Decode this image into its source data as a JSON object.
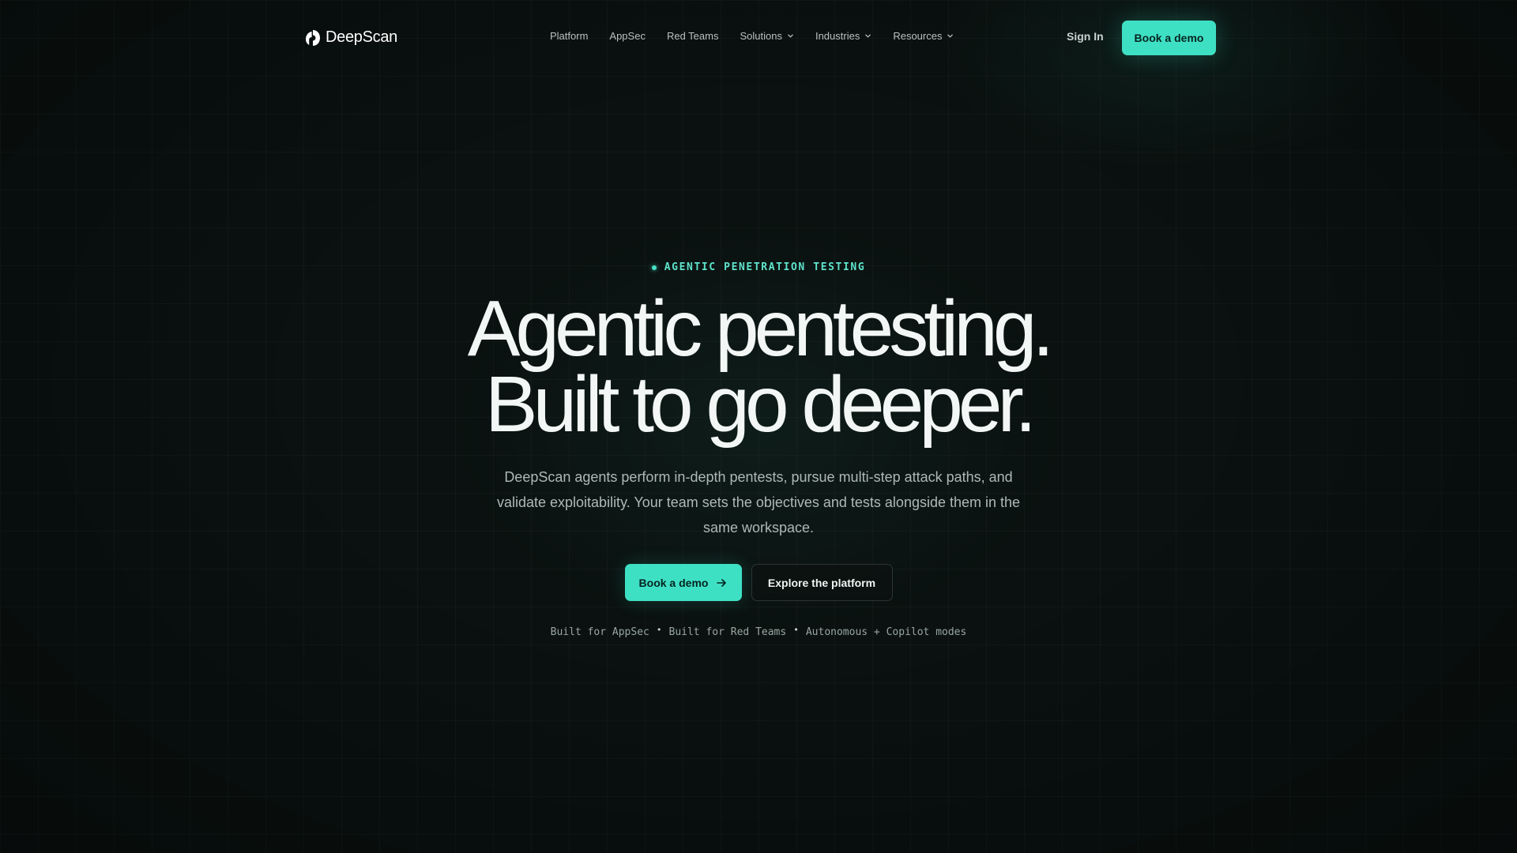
{
  "brand": {
    "name": "DeepScan",
    "accent_color": "#3ee0c4"
  },
  "nav": {
    "links": [
      {
        "label": "Platform",
        "has_dropdown": false
      },
      {
        "label": "AppSec",
        "has_dropdown": false
      },
      {
        "label": "Red Teams",
        "has_dropdown": false
      },
      {
        "label": "Solutions",
        "has_dropdown": true
      },
      {
        "label": "Industries",
        "has_dropdown": true
      },
      {
        "label": "Resources",
        "has_dropdown": true
      }
    ],
    "sign_in_label": "Sign In",
    "demo_label": "Book a demo"
  },
  "hero": {
    "eyebrow": "AGENTIC PENETRATION TESTING",
    "headline_line1": "Agentic pentesting.",
    "headline_line2": "Built to go deeper.",
    "subtitle": "DeepScan agents perform in-depth pentests, pursue multi-step attack paths, and validate exploitability. Your team sets the objectives and tests alongside them in the same workspace.",
    "primary_cta": "Book a demo",
    "secondary_cta": "Explore the platform",
    "tagline_items": [
      "Built for AppSec",
      "Built for Red Teams",
      "Autonomous + Copilot modes"
    ],
    "tagline_separator": "•"
  }
}
